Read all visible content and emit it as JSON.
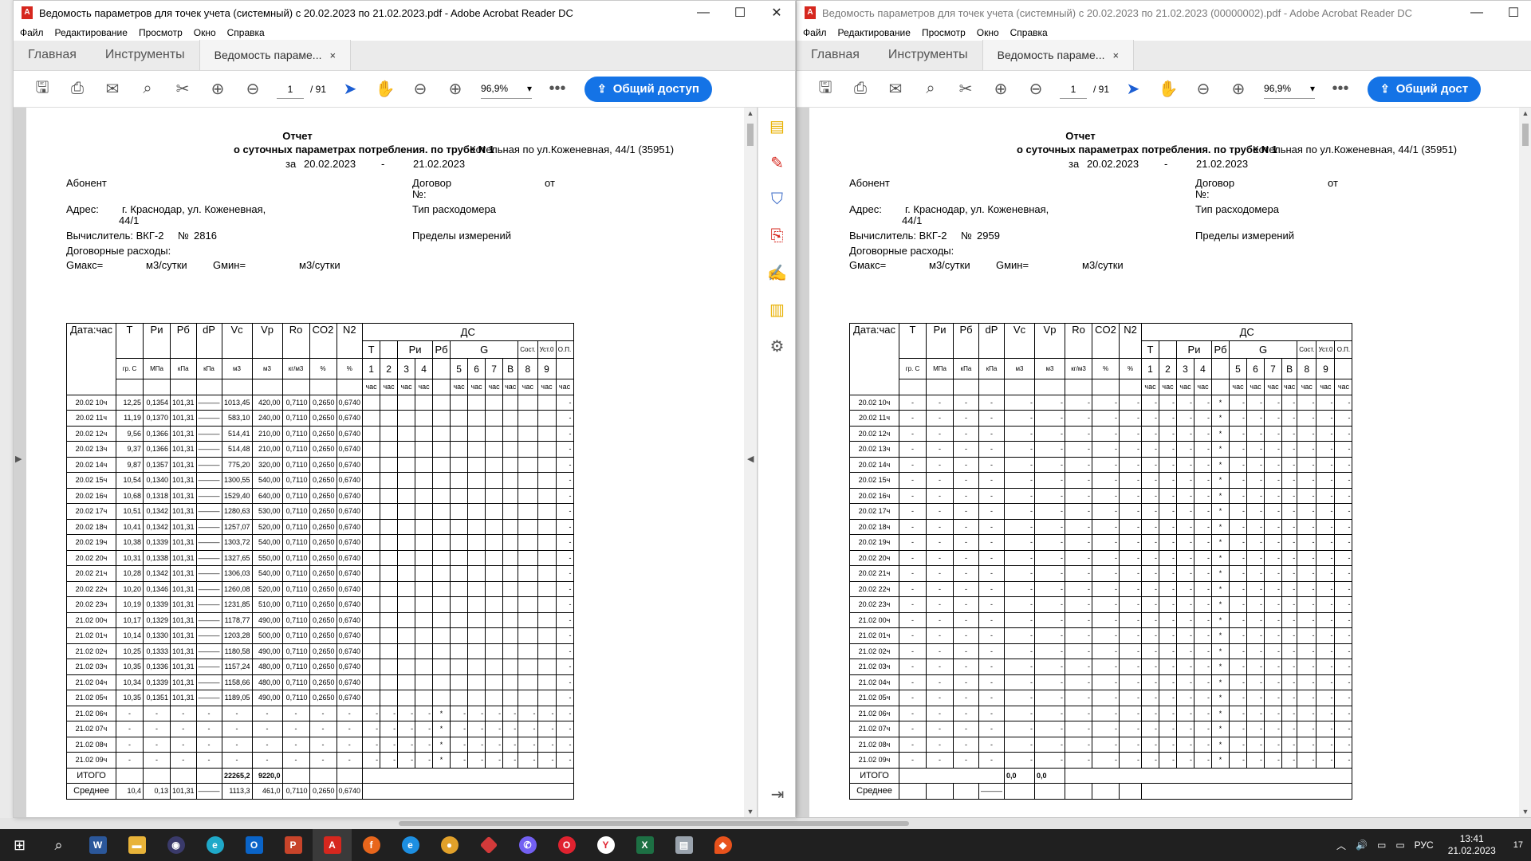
{
  "window1": {
    "title": "Ведомость параметров для точек учета (системный) с 20.02.2023 по 21.02.2023.pdf - Adobe Acrobat Reader DC",
    "menu": [
      "Файл",
      "Редактирование",
      "Просмотр",
      "Окно",
      "Справка"
    ],
    "tabs": {
      "home": "Главная",
      "tools": "Инструменты",
      "doc": "Ведомость параме...",
      "close": "×"
    },
    "page_current": "1",
    "page_total": "/ 91",
    "zoom": "96,9%",
    "share": "Общий доступ",
    "report": {
      "title": "Отчет",
      "subtitle": "о суточных параметрах потребления. по трубе N 1",
      "boiler": "Котельная по ул.Коженевная, 44/1 (35951)",
      "period_prefix": "за",
      "period_from": "20.02.2023",
      "period_dash": "-",
      "period_to": "21.02.2023",
      "subscriber": "Абонент",
      "contract": "Договор",
      "contract_no": "№:",
      "from": "от",
      "address_label": "Адрес:",
      "address": "г. Краснодар, ул. Коженевная,",
      "address2": "44/1",
      "meter_type": "Тип расходомера",
      "calc_label": "Вычислитель: ВКГ-2",
      "calc_no_label": "№",
      "calc_no": "2816",
      "limits": "Пределы измерений",
      "contract_flows": "Договорные расходы:",
      "gmax": "Gмакс=",
      "unit1": "м3/сутки",
      "gmin": "Gмин=",
      "unit2": "м3/сутки"
    },
    "rows": [
      [
        "20.02 10ч",
        "12,25",
        "0,1354",
        "101,31",
        "———",
        "1013,45",
        "420,00",
        "0,7110",
        "0,2650",
        "0,6740"
      ],
      [
        "20.02 11ч",
        "11,19",
        "0,1370",
        "101,31",
        "———",
        "583,10",
        "240,00",
        "0,7110",
        "0,2650",
        "0,6740"
      ],
      [
        "20.02 12ч",
        "9,56",
        "0,1366",
        "101,31",
        "———",
        "514,41",
        "210,00",
        "0,7110",
        "0,2650",
        "0,6740"
      ],
      [
        "20.02 13ч",
        "9,37",
        "0,1366",
        "101,31",
        "———",
        "514,48",
        "210,00",
        "0,7110",
        "0,2650",
        "0,6740"
      ],
      [
        "20.02 14ч",
        "9,87",
        "0,1357",
        "101,31",
        "———",
        "775,20",
        "320,00",
        "0,7110",
        "0,2650",
        "0,6740"
      ],
      [
        "20.02 15ч",
        "10,54",
        "0,1340",
        "101,31",
        "———",
        "1300,55",
        "540,00",
        "0,7110",
        "0,2650",
        "0,6740"
      ],
      [
        "20.02 16ч",
        "10,68",
        "0,1318",
        "101,31",
        "———",
        "1529,40",
        "640,00",
        "0,7110",
        "0,2650",
        "0,6740"
      ],
      [
        "20.02 17ч",
        "10,51",
        "0,1342",
        "101,31",
        "———",
        "1280,63",
        "530,00",
        "0,7110",
        "0,2650",
        "0,6740"
      ],
      [
        "20.02 18ч",
        "10,41",
        "0,1342",
        "101,31",
        "———",
        "1257,07",
        "520,00",
        "0,7110",
        "0,2650",
        "0,6740"
      ],
      [
        "20.02 19ч",
        "10,38",
        "0,1339",
        "101,31",
        "———",
        "1303,72",
        "540,00",
        "0,7110",
        "0,2650",
        "0,6740"
      ],
      [
        "20.02 20ч",
        "10,31",
        "0,1338",
        "101,31",
        "———",
        "1327,65",
        "550,00",
        "0,7110",
        "0,2650",
        "0,6740"
      ],
      [
        "20.02 21ч",
        "10,28",
        "0,1342",
        "101,31",
        "———",
        "1306,03",
        "540,00",
        "0,7110",
        "0,2650",
        "0,6740"
      ],
      [
        "20.02 22ч",
        "10,20",
        "0,1346",
        "101,31",
        "———",
        "1260,08",
        "520,00",
        "0,7110",
        "0,2650",
        "0,6740"
      ],
      [
        "20.02 23ч",
        "10,19",
        "0,1339",
        "101,31",
        "———",
        "1231,85",
        "510,00",
        "0,7110",
        "0,2650",
        "0,6740"
      ],
      [
        "21.02 00ч",
        "10,17",
        "0,1329",
        "101,31",
        "———",
        "1178,77",
        "490,00",
        "0,7110",
        "0,2650",
        "0,6740"
      ],
      [
        "21.02 01ч",
        "10,14",
        "0,1330",
        "101,31",
        "———",
        "1203,28",
        "500,00",
        "0,7110",
        "0,2650",
        "0,6740"
      ],
      [
        "21.02 02ч",
        "10,25",
        "0,1333",
        "101,31",
        "———",
        "1180,58",
        "490,00",
        "0,7110",
        "0,2650",
        "0,6740"
      ],
      [
        "21.02 03ч",
        "10,35",
        "0,1336",
        "101,31",
        "———",
        "1157,24",
        "480,00",
        "0,7110",
        "0,2650",
        "0,6740"
      ],
      [
        "21.02 04ч",
        "10,34",
        "0,1339",
        "101,31",
        "———",
        "1158,66",
        "480,00",
        "0,7110",
        "0,2650",
        "0,6740"
      ],
      [
        "21.02 05ч",
        "10,35",
        "0,1351",
        "101,31",
        "———",
        "1189,05",
        "490,00",
        "0,7110",
        "0,2650",
        "0,6740"
      ],
      [
        "21.02 06ч",
        "-",
        "-",
        "-",
        "-",
        "-",
        "-",
        "-",
        "-",
        "-"
      ],
      [
        "21.02 07ч",
        "-",
        "-",
        "-",
        "-",
        "-",
        "-",
        "-",
        "-",
        "-"
      ],
      [
        "21.02 08ч",
        "-",
        "-",
        "-",
        "-",
        "-",
        "-",
        "-",
        "-",
        "-"
      ],
      [
        "21.02 09ч",
        "-",
        "-",
        "-",
        "-",
        "-",
        "-",
        "-",
        "-",
        "-"
      ]
    ],
    "total_row": [
      "ИТОГО",
      "",
      "",
      "",
      "",
      "22265,2",
      "9220,0",
      "",
      "",
      ""
    ],
    "avg_row": [
      "Среднее",
      "10,4",
      "0,13",
      "101,31",
      "———",
      "1113,3",
      "461,0",
      "0,7110",
      "0,2650",
      "0,6740"
    ]
  },
  "window2": {
    "title": "Ведомость параметров для точек учета (системный) с 20.02.2023 по 21.02.2023 (00000002).pdf - Adobe Acrobat Reader DC",
    "menu": [
      "Файл",
      "Редактирование",
      "Просмотр",
      "Окно",
      "Справка"
    ],
    "tabs": {
      "home": "Главная",
      "tools": "Инструменты",
      "doc": "Ведомость параме...",
      "close": "×"
    },
    "page_current": "1",
    "page_total": "/ 91",
    "zoom": "96,9%",
    "share": "Общий дост",
    "report": {
      "title": "Отчет",
      "subtitle": "о суточных параметрах потребления. по трубе N 1",
      "boiler": "Котельная по ул.Коженевная, 44/1 (35951)",
      "period_prefix": "за",
      "period_from": "20.02.2023",
      "period_dash": "-",
      "period_to": "21.02.2023",
      "subscriber": "Абонент",
      "contract": "Договор",
      "contract_no": "№:",
      "from": "от",
      "address_label": "Адрес:",
      "address": "г. Краснодар, ул. Коженевная,",
      "address2": "44/1",
      "meter_type": "Тип расходомера",
      "calc_label": "Вычислитель: ВКГ-2",
      "calc_no_label": "№",
      "calc_no": "2959",
      "limits": "Пределы измерений",
      "contract_flows": "Договорные расходы:",
      "gmax": "Gмакс=",
      "unit1": "м3/сутки",
      "gmin": "Gмин=",
      "unit2": "м3/сутки"
    },
    "row_labels": [
      "20.02 10ч",
      "20.02 11ч",
      "20.02 12ч",
      "20.02 13ч",
      "20.02 14ч",
      "20.02 15ч",
      "20.02 16ч",
      "20.02 17ч",
      "20.02 18ч",
      "20.02 19ч",
      "20.02 20ч",
      "20.02 21ч",
      "20.02 22ч",
      "20.02 23ч",
      "21.02 00ч",
      "21.02 01ч",
      "21.02 02ч",
      "21.02 03ч",
      "21.02 04ч",
      "21.02 05ч",
      "21.02 06ч",
      "21.02 07ч",
      "21.02 08ч",
      "21.02 09ч"
    ],
    "empty": "-",
    "total_label": "ИТОГО",
    "total_vc": "0,0",
    "total_vp": "0,0",
    "avg_label": "Среднее",
    "avg_dp": "———"
  },
  "table_header": {
    "main": [
      "Дата:час",
      "T",
      "Ри",
      "Рб",
      "dP",
      "Vc",
      "Vp",
      "Ro",
      "CO2",
      "N2",
      "ДС"
    ],
    "units": [
      "гр. С",
      "МПа",
      "кПа",
      "кПа",
      "м3",
      "м3",
      "кг/м3",
      "%",
      "%"
    ],
    "ds_groups": [
      "T",
      "Ри",
      "Рб",
      "G",
      "Сост.",
      "Уст.0",
      "О.П."
    ],
    "ds_nums": [
      "1",
      "2",
      "3",
      "4",
      "",
      "5",
      "6",
      "7",
      "В",
      "8",
      "9",
      ""
    ],
    "ds_hours": [
      "час",
      "час",
      "час",
      "час",
      "",
      "час",
      "час",
      "час",
      "час",
      "час",
      "час",
      "час"
    ],
    "flag": "*"
  },
  "taskbar": {
    "time": "13:41",
    "date": "21.02.2023",
    "lang": "РУС",
    "notif_count": "17",
    "apps": [
      "windows-start",
      "search",
      "word",
      "file-explorer",
      "browser",
      "edge",
      "outlook",
      "powerpoint",
      "acrobat",
      "firefox",
      "ie",
      "chrome",
      "app-diamond",
      "viber",
      "opera",
      "yandex",
      "excel",
      "notes",
      "app-drop"
    ]
  }
}
